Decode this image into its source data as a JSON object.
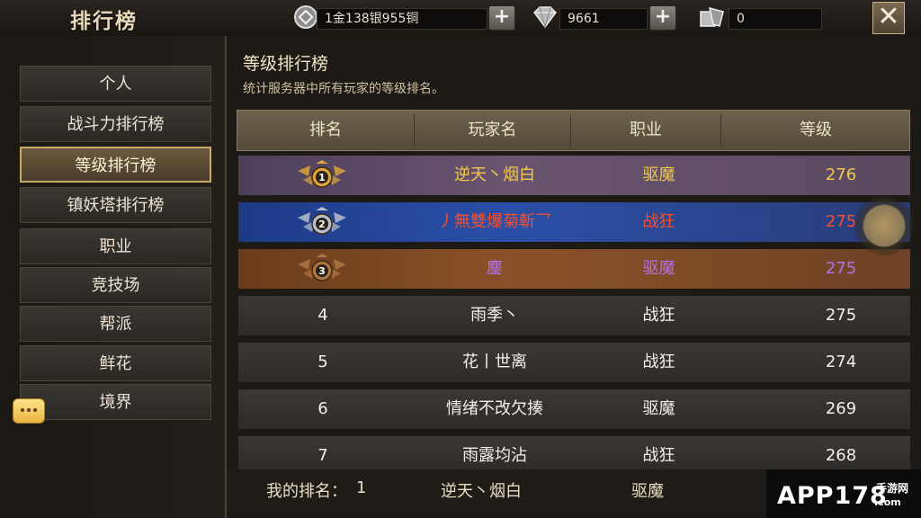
{
  "header": {
    "title": "排行榜",
    "currency": "1金138银955铜",
    "diamonds": "9661",
    "tokens": "0",
    "close_icon": "close-x"
  },
  "sidebar": {
    "items": [
      {
        "label": "个人",
        "active": false
      },
      {
        "label": "战斗力排行榜",
        "active": false
      },
      {
        "label": "等级排行榜",
        "active": true
      },
      {
        "label": "镇妖塔排行榜",
        "active": false
      },
      {
        "label": "职业",
        "active": false
      },
      {
        "label": "竞技场",
        "active": false
      },
      {
        "label": "帮派",
        "active": false
      },
      {
        "label": "鲜花",
        "active": false
      },
      {
        "label": "境界",
        "active": false
      }
    ]
  },
  "main": {
    "heading": "等级排行榜",
    "description": "统计服务器中所有玩家的等级排名。",
    "columns": [
      "排名",
      "玩家名",
      "职业",
      "等级"
    ],
    "rows": [
      {
        "rank": "1",
        "name": "逆天丶烟白",
        "class": "驱魔",
        "level": "276",
        "color": "#f2c84a"
      },
      {
        "rank": "2",
        "name": "丿無雙爆菊斬乛",
        "class": "战狂",
        "level": "275",
        "color": "#f05030"
      },
      {
        "rank": "3",
        "name": "鏖",
        "class": "驱魔",
        "level": "275",
        "color": "#b070e8"
      },
      {
        "rank": "4",
        "name": "雨季丶",
        "class": "战狂",
        "level": "275",
        "color": "#f0f0f0"
      },
      {
        "rank": "5",
        "name": "花丨世离",
        "class": "战狂",
        "level": "274",
        "color": "#f0f0f0"
      },
      {
        "rank": "6",
        "name": "情绪不改欠揍",
        "class": "驱魔",
        "level": "269",
        "color": "#f0f0f0"
      },
      {
        "rank": "7",
        "name": "雨露均沾",
        "class": "战狂",
        "level": "268",
        "color": "#f0f0f0"
      }
    ],
    "my_rank": {
      "label": "我的排名：",
      "rank": "1",
      "name": "逆天丶烟白",
      "class": "驱魔"
    }
  },
  "watermark": {
    "brand": "APP178",
    "sub": "手游网",
    "domain": ".com"
  }
}
